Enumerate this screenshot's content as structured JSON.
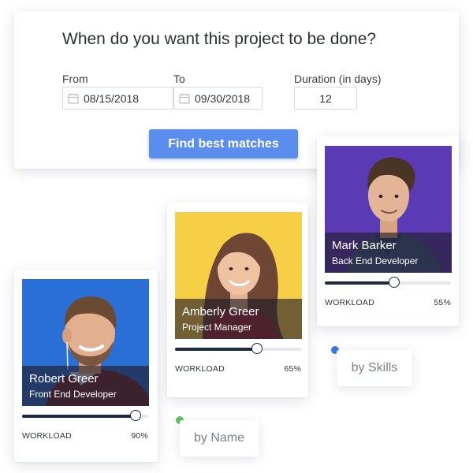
{
  "search": {
    "question": "When do you want this project to be done?",
    "from_label": "From",
    "from_value": "08/15/2018",
    "to_label": "To",
    "to_value": "09/30/2018",
    "duration_label": "Duration (in days)",
    "duration_value": "12",
    "button_label": "Find best matches",
    "accent_color": "#5a8dee"
  },
  "people": [
    {
      "name": "Robert  Greer",
      "role": "Front End Developer",
      "workload_label": "WORKLOAD",
      "workload_value": "90%",
      "workload_fraction": 0.9,
      "photo_bg": "#2a6fd6"
    },
    {
      "name": "Amberly  Greer",
      "role": "Project Manager",
      "workload_label": "WORKLOAD",
      "workload_value": "65%",
      "workload_fraction": 0.65,
      "photo_bg": "#f7cf47"
    },
    {
      "name": "Mark Barker",
      "role": "Back End Developer",
      "workload_label": "WORKLOAD",
      "workload_value": "55%",
      "workload_fraction": 0.55,
      "photo_bg": "#5b3ab5"
    }
  ],
  "filters": {
    "by_skills": "by Skills",
    "by_name": "by Name",
    "skills_dot_color": "#3a7be0",
    "name_dot_color": "#5cc15c"
  },
  "icons": {
    "calendar": "calendar-icon",
    "slider_knob": "slider-knob"
  }
}
